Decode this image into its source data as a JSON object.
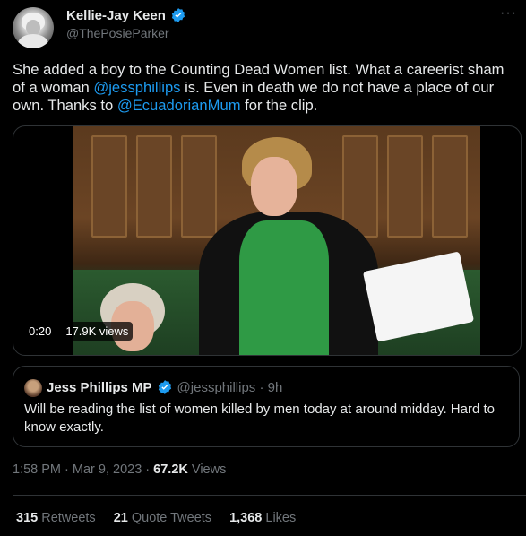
{
  "author": {
    "display_name": "Kellie-Jay Keen",
    "handle": "@ThePosieParker",
    "avatar_icon": "profile-photo",
    "verified_icon": "verified-badge-icon"
  },
  "more_icon": "more-options-icon",
  "more_label": "···",
  "tweet": {
    "part1": "She added a boy to the Counting Dead Women list.  What a careerist sham of a woman ",
    "mention1": "@jessphillips",
    "part2": "  is.  Even in death we do not have a place of our own.  Thanks to ",
    "mention2": "@EcuadorianMum",
    "part3": " for the clip."
  },
  "video": {
    "duration": "0:20",
    "views": "17.9K views"
  },
  "quote": {
    "display_name": "Jess Phillips MP",
    "handle": "@jessphillips",
    "sep": " · ",
    "age": "9h",
    "text": "Will be reading the list of women killed by men today at around midday. Hard to know exactly."
  },
  "meta": {
    "time": "1:58 PM",
    "sep1": " · ",
    "date": "Mar 9, 2023",
    "sep2": " · ",
    "views_count": "67.2K",
    "views_label": " Views"
  },
  "stats": [
    {
      "count": "315",
      "label": "Retweets"
    },
    {
      "count": "21",
      "label": "Quote Tweets"
    },
    {
      "count": "1,368",
      "label": "Likes"
    }
  ],
  "colors": {
    "background": "#000000",
    "text": "#e7e9ea",
    "muted": "#71767b",
    "accent": "#1d9bf0",
    "border": "#2f3336"
  }
}
